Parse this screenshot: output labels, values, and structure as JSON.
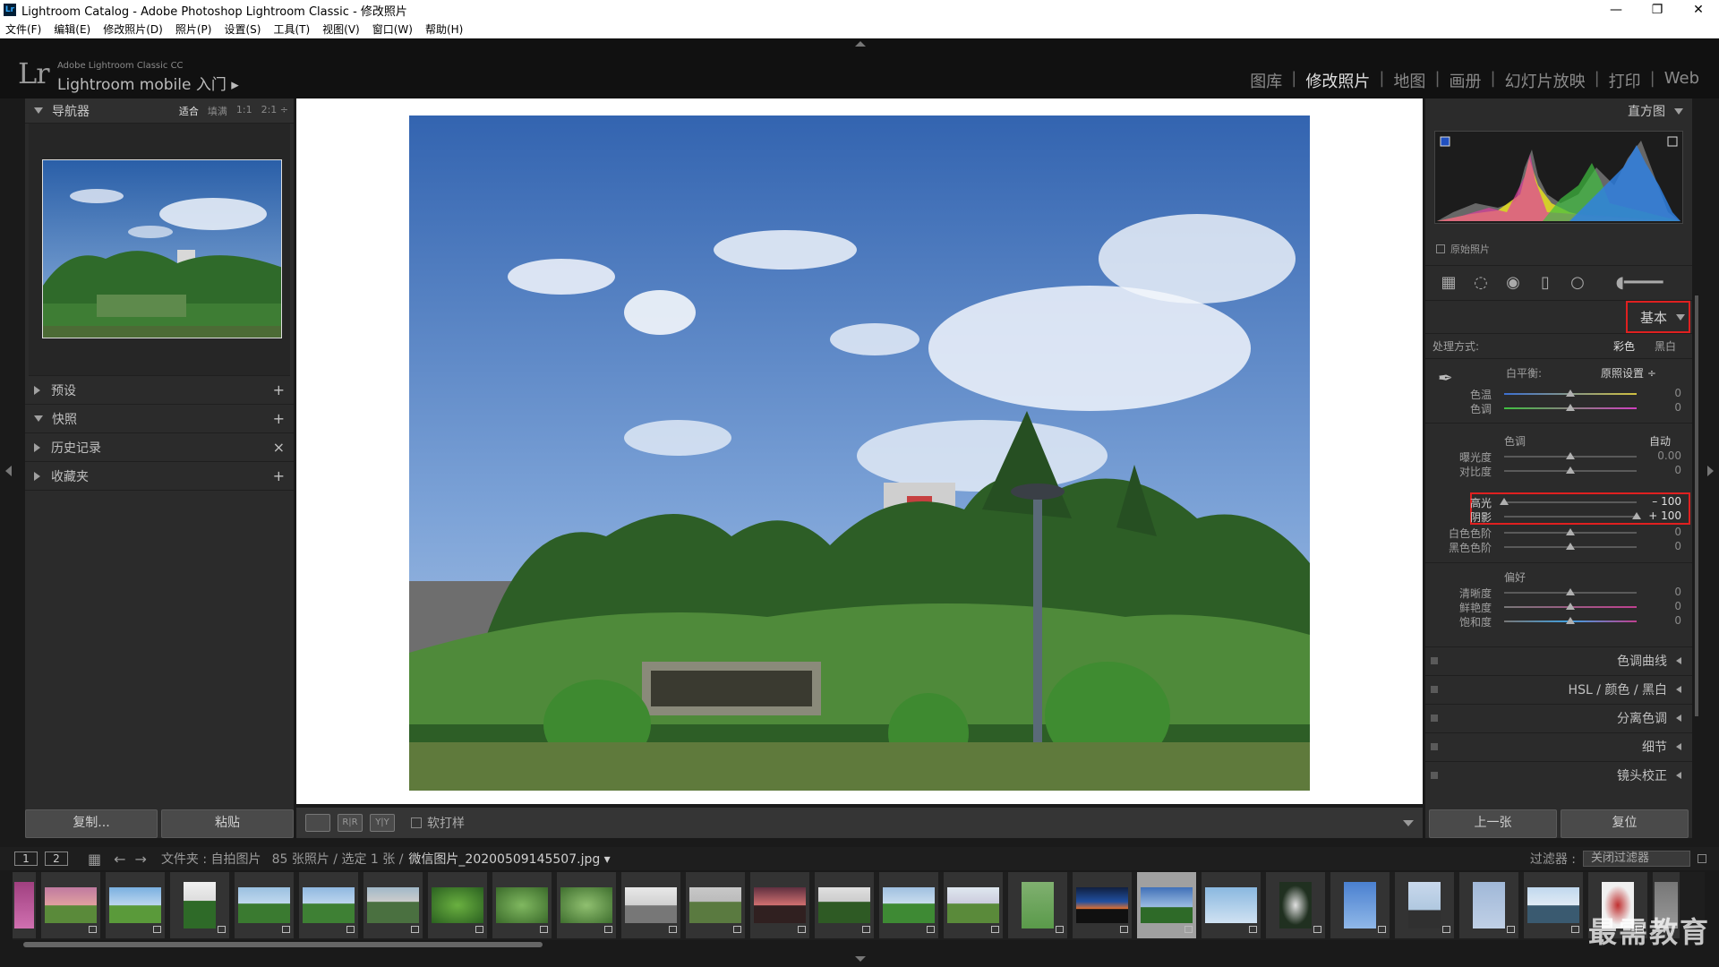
{
  "window": {
    "title": "Lightroom Catalog - Adobe Photoshop Lightroom Classic - 修改照片",
    "app_icon": "Lr",
    "controls": [
      "—",
      "❐",
      "✕"
    ]
  },
  "menu": [
    "文件(F)",
    "编辑(E)",
    "修改照片(D)",
    "照片(P)",
    "设置(S)",
    "工具(T)",
    "视图(V)",
    "窗口(W)",
    "帮助(H)"
  ],
  "header": {
    "logo": "Lr",
    "product": "Adobe Lightroom Classic CC",
    "mobile": "Lightroom mobile 入门 ▸",
    "modules": [
      "图库",
      "修改照片",
      "地图",
      "画册",
      "幻灯片放映",
      "打印",
      "Web"
    ],
    "active_module": "修改照片"
  },
  "left": {
    "navigator": {
      "title": "导航器",
      "options": [
        "适合",
        "填满",
        "1:1",
        "2:1 ÷"
      ]
    },
    "panels": [
      {
        "label": "预设",
        "action": "+"
      },
      {
        "label": "快照",
        "action": "+"
      },
      {
        "label": "历史记录",
        "action": "×"
      },
      {
        "label": "收藏夹",
        "action": "+"
      }
    ],
    "copy": "复制...",
    "paste": "粘贴"
  },
  "toolbar": {
    "btn1": "",
    "btn2": "R|R",
    "btn3": "Y|Y",
    "soft_proof": "软打样"
  },
  "right": {
    "histogram": "直方图",
    "original": "原始照片",
    "basic": "基本",
    "treatment_label": "处理方式:",
    "treatment_color": "彩色",
    "treatment_bw": "黑白",
    "wb_label": "白平衡:",
    "wb_value": "原照设置 ÷",
    "tone_label": "色调",
    "auto": "自动",
    "presence_label": "偏好",
    "sliders": [
      {
        "label": "色温",
        "value": "0",
        "pos": 0.5
      },
      {
        "label": "色调",
        "value": "0",
        "pos": 0.5
      },
      {
        "label": "曝光度",
        "value": "0.00",
        "pos": 0.5
      },
      {
        "label": "对比度",
        "value": "0",
        "pos": 0.5
      },
      {
        "label": "高光",
        "value": "– 100",
        "pos": 0.0
      },
      {
        "label": "阴影",
        "value": "+ 100",
        "pos": 1.0
      },
      {
        "label": "白色色阶",
        "value": "0",
        "pos": 0.5
      },
      {
        "label": "黑色色阶",
        "value": "0",
        "pos": 0.5
      },
      {
        "label": "清晰度",
        "value": "0",
        "pos": 0.5
      },
      {
        "label": "鲜艳度",
        "value": "0",
        "pos": 0.5
      },
      {
        "label": "饱和度",
        "value": "0",
        "pos": 0.5
      }
    ],
    "collapsed": [
      "色调曲线",
      "HSL / 颜色 / 黑白",
      "分离色调",
      "细节",
      "镜头校正"
    ],
    "prev": "上一张",
    "reset": "复位"
  },
  "filmstrip": {
    "views": [
      "1",
      "2"
    ],
    "path": "文件夹 : 自拍图片",
    "count": "85 张照片 / 选定 1 张 /",
    "filename": "微信图片_20200509145507.jpg ▾",
    "filter_label": "过滤器 :",
    "filter_value": "关闭过滤器"
  },
  "watermark": "最需教育",
  "colors": {
    "accent_red": "#e02020",
    "panel": "#2b2b2b",
    "background": "#1a1a1a"
  }
}
